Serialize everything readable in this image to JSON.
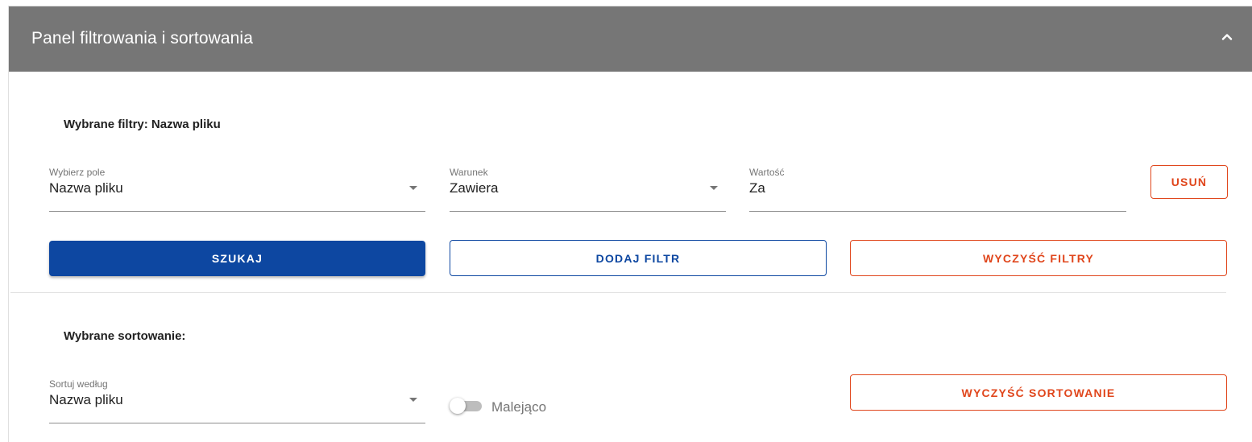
{
  "header": {
    "title": "Panel filtrowania i sortowania",
    "collapse_icon": "chevron-up-icon"
  },
  "filters": {
    "section_title": "Wybrane filtry: Nazwa pliku",
    "field": {
      "label": "Wybierz pole",
      "value": "Nazwa pliku"
    },
    "condition": {
      "label": "Warunek",
      "value": "Zawiera"
    },
    "value": {
      "label": "Wartość",
      "value": "Za"
    },
    "remove_label": "USUŃ",
    "search_label": "SZUKAJ",
    "add_filter_label": "DODAJ FILTR",
    "clear_filters_label": "WYCZYŚĆ FILTRY"
  },
  "sorting": {
    "section_title": "Wybrane sortowanie:",
    "sort_by": {
      "label": "Sortuj według",
      "value": "Nazwa pliku"
    },
    "descending_label": "Malejąco",
    "descending_on": false,
    "clear_sorting_label": "WYCZYŚĆ SORTOWANIE"
  },
  "colors": {
    "header_bg": "#767676",
    "primary": "#0d47a1",
    "danger": "#e0461c"
  }
}
